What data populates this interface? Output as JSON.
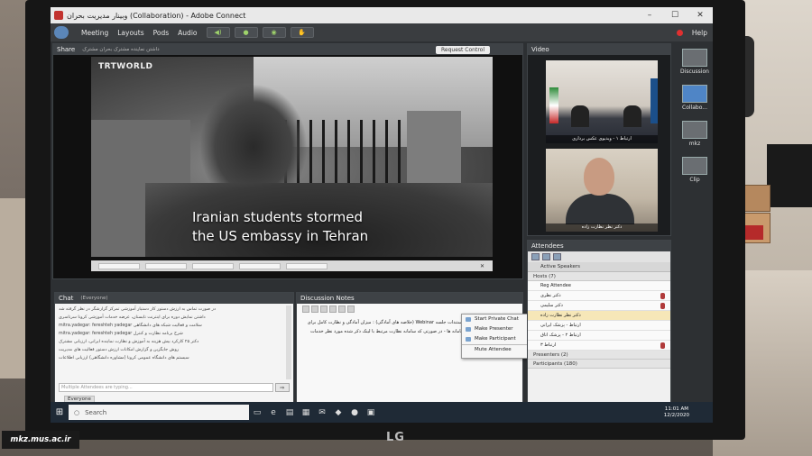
{
  "window": {
    "title": "وبینار مدیریت بحران (Collaboration) - Adobe Connect",
    "controls": [
      "–",
      "☐",
      "✕"
    ]
  },
  "menu": {
    "items": [
      "Meeting",
      "Layouts",
      "Pods",
      "Audio"
    ],
    "help": "Help"
  },
  "share": {
    "title": "Share",
    "subtitle": "داشتن نماینده مشترک بحران مشترک",
    "request_control": "Request Control",
    "watermark": "TRTWORLD",
    "caption_line1": "Iranian students stormed",
    "caption_line2": "the US embassy in Tehran"
  },
  "video": {
    "title": "Video",
    "feed1_label": "ارتباط ۱ - ویدیوی عکس برداری",
    "feed2_label": "دکتر نظر نظارت زاده"
  },
  "layouts": [
    "Discussion",
    "Collabo...",
    "mkz",
    "Clip"
  ],
  "chat": {
    "title": "Chat",
    "subtitle": "(Everyone)",
    "messages": [
      "در صورت تماس به ارزش دستور کار دستیار آموزشی تمرکز گزارشگر در نظر گرفته شد",
      "داشتن نمایش دوره برای اینترنت تابستان، عرضه خدمات آموزشی کرونا سرتاسری",
      "mitra.yadegar: fereshteh yadegar   سلامت و فعالیت شبکه های دانشگاهی",
      "mitra.yadegar: fereshteh yadegar   شرح برنامه نظارت و کنترل",
      "دکتر ۲۵ کارکرد بیش هزینه به آموزش و نظارت نماینده ایرانی، ارزیابی مشترک",
      "روش جایگزین و گزارش امکانات ارزش دستور فعالیت های مدیریت",
      "سیستم های دانشگاه عمومی کرونا (مشاوره دانشگاهی) ارزیابی اطلاعات"
    ],
    "placeholder": "Multiple Attendees are typing...",
    "send": "⇨",
    "tab": "Everyone"
  },
  "notes": {
    "title": "Discussion Notes",
    "text": "مستندات جلسه Webinar (خلاصه های آمادگی) : میزان آمادگی و نظارت کامل برای سامانه ها - در صورتی که سامانه نظارت مرتبط با لینک ذکر شده مورد نظر خدمات"
  },
  "context_menu": [
    "Start Private Chat",
    "Make Presenter",
    "Make Participant",
    "Mute Attendee"
  ],
  "attendees": {
    "title": "Attendees",
    "active_speakers": "Active Speakers",
    "hosts_group": "Hosts (7)",
    "hosts": [
      "Reg Attendee",
      "دکتر نظری",
      "دکتر سلیمی",
      "دکتر نظر نظارت زاده",
      "ارتباط - پزشک ایرانی",
      "ارتباط ۲ - پزشک اتاق",
      "ارتباط ۳"
    ],
    "presenters_group": "Presenters (2)",
    "participants_group": "Participants (180)"
  },
  "taskbar": {
    "search": "Search",
    "time": "11:01 AM",
    "date": "12/2/2020"
  },
  "monitor_brand": "LG",
  "source_watermark": "mkz.mus.ac.ir"
}
